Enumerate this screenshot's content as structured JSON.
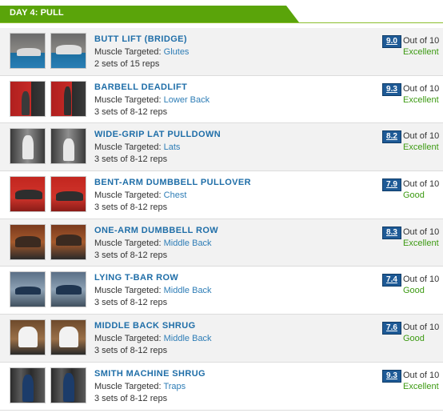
{
  "day": {
    "title": "DAY 4: PULL",
    "color": "#5aa40a"
  },
  "colors": {
    "link": "#1f6ea8",
    "muscle": "#2e7db6",
    "good": "#3c9a12",
    "score_bg": "#1e5a96"
  },
  "exercises": [
    {
      "name": "BUTT LIFT (BRIDGE)",
      "target_label": "Muscle Targeted:",
      "muscle": "Glutes",
      "sets": "2 sets of 15 reps",
      "score": "9.0",
      "out_of": "Out of 10",
      "verdict": "Excellent"
    },
    {
      "name": "BARBELL DEADLIFT",
      "target_label": "Muscle Targeted:",
      "muscle": "Lower Back",
      "sets": "3 sets of 8-12 reps",
      "score": "9.3",
      "out_of": "Out of 10",
      "verdict": "Excellent"
    },
    {
      "name": "WIDE-GRIP LAT PULLDOWN",
      "target_label": "Muscle Targeted:",
      "muscle": "Lats",
      "sets": "3 sets of 8-12 reps",
      "score": "8.2",
      "out_of": "Out of 10",
      "verdict": "Excellent"
    },
    {
      "name": "BENT-ARM DUMBBELL PULLOVER",
      "target_label": "Muscle Targeted:",
      "muscle": "Chest",
      "sets": "3 sets of 8-12 reps",
      "score": "7.9",
      "out_of": "Out of 10",
      "verdict": "Good"
    },
    {
      "name": "ONE-ARM DUMBBELL ROW",
      "target_label": "Muscle Targeted:",
      "muscle": "Middle Back",
      "sets": "3 sets of 8-12 reps",
      "score": "8.3",
      "out_of": "Out of 10",
      "verdict": "Excellent"
    },
    {
      "name": "LYING T-BAR ROW",
      "target_label": "Muscle Targeted:",
      "muscle": "Middle Back",
      "sets": "3 sets of 8-12 reps",
      "score": "7.4",
      "out_of": "Out of 10",
      "verdict": "Good"
    },
    {
      "name": "MIDDLE BACK SHRUG",
      "target_label": "Muscle Targeted:",
      "muscle": "Middle Back",
      "sets": "3 sets of 8-12 reps",
      "score": "7.6",
      "out_of": "Out of 10",
      "verdict": "Good"
    },
    {
      "name": "SMITH MACHINE SHRUG",
      "target_label": "Muscle Targeted:",
      "muscle": "Traps",
      "sets": "3 sets of 8-12 reps",
      "score": "9.3",
      "out_of": "Out of 10",
      "verdict": "Excellent"
    }
  ]
}
